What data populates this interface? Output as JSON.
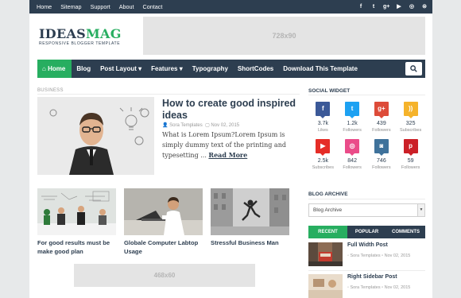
{
  "topbar": {
    "links": [
      "Home",
      "Sitemap",
      "Support",
      "About",
      "Contact"
    ],
    "icons": [
      "facebook-icon",
      "twitter-icon",
      "google-plus-icon",
      "youtube-icon",
      "dribbble-icon",
      "rss-icon"
    ]
  },
  "logo": {
    "part1": "IDEAS",
    "part2": "MAG",
    "tagline": "RESPONSIVE BLOGGER TEMPLATE"
  },
  "ad_top": "728x90",
  "nav": {
    "home": "Home",
    "items": [
      "Blog",
      "Post Layout",
      "Features",
      "Typography",
      "ShortCodes",
      "Download This Template"
    ]
  },
  "main": {
    "section_label": "BUSINESS",
    "featured": {
      "title": "How to create good inspired ideas",
      "author": "Sora Templates",
      "date": "Nov 02, 2015",
      "excerpt": "What is Lorem Ipsum?Lorem Ipsum is simply dummy text of the printing and typesetting ...",
      "read_more": "Read More"
    },
    "cards": [
      {
        "title": "For good results must be make good plan"
      },
      {
        "title": "Globale Computer Labtop Usage"
      },
      {
        "title": "Stressful Business Man"
      }
    ],
    "ad_bottom": "468x60"
  },
  "sidebar": {
    "social_heading": "SOCIAL WIDGET",
    "social": [
      {
        "icon": "facebook-icon",
        "glyph": "f",
        "color": "#3b5998",
        "count": "3.7k",
        "label": "Likes"
      },
      {
        "icon": "twitter-icon",
        "glyph": "t",
        "color": "#1da1f2",
        "count": "1.2k",
        "label": "Followers"
      },
      {
        "icon": "google-plus-icon",
        "glyph": "g+",
        "color": "#dd4b39",
        "count": "439",
        "label": "Followers"
      },
      {
        "icon": "rss-icon",
        "glyph": "))",
        "color": "#f5b32b",
        "count": "325",
        "label": "Subscribes"
      },
      {
        "icon": "youtube-icon",
        "glyph": "▶",
        "color": "#e52d27",
        "count": "2.5k",
        "label": "Subscribes"
      },
      {
        "icon": "dribbble-icon",
        "glyph": "◎",
        "color": "#ea4c89",
        "count": "842",
        "label": "Followers"
      },
      {
        "icon": "instagram-icon",
        "glyph": "◙",
        "color": "#3f729b",
        "count": "746",
        "label": "Followers"
      },
      {
        "icon": "pinterest-icon",
        "glyph": "p",
        "color": "#cb2027",
        "count": "59",
        "label": "Followers"
      }
    ],
    "archive_heading": "BLOG ARCHIVE",
    "archive_select": "Blog Archive",
    "tabs": [
      "RECENT",
      "POPULAR",
      "COMMENTS"
    ],
    "recent": [
      {
        "title": "Full Width Post",
        "author": "Sora Templates",
        "date": "Nov 02, 2015"
      },
      {
        "title": "Right Sidebar Post",
        "author": "Sora Templates",
        "date": "Nov 02, 2015"
      }
    ]
  },
  "colors": {
    "navy": "#2d3e50",
    "green": "#27ae60"
  }
}
